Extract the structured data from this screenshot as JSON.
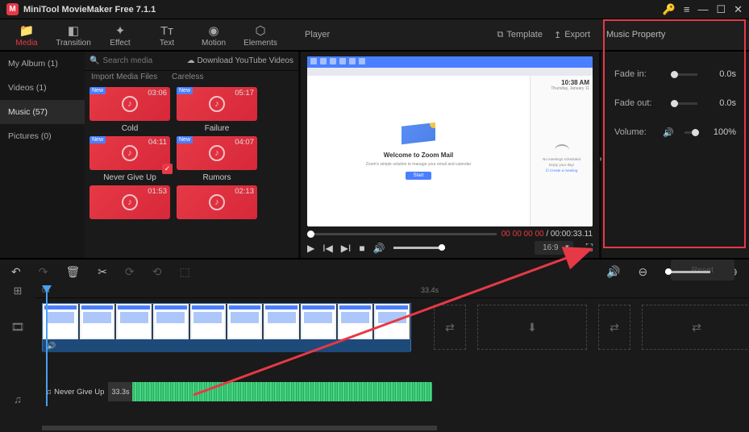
{
  "app": {
    "title": "MiniTool MovieMaker Free 7.1.1",
    "logo_letter": "M"
  },
  "window_controls": {
    "key": "🔑",
    "menu": "≡",
    "min": "—",
    "max": "☐",
    "close": "✕"
  },
  "tools": [
    {
      "icon": "📁",
      "label": "Media",
      "active": true
    },
    {
      "icon": "◧",
      "label": "Transition"
    },
    {
      "icon": "✦",
      "label": "Effect"
    },
    {
      "icon": "Tᴛ",
      "label": "Text"
    },
    {
      "icon": "◉",
      "label": "Motion"
    },
    {
      "icon": "⬡",
      "label": "Elements"
    }
  ],
  "player_header": {
    "title": "Player",
    "template": "Template",
    "export": "Export"
  },
  "prop_header": "Music Property",
  "sidebar": [
    {
      "label": "My Album (1)"
    },
    {
      "label": "Videos (1)"
    },
    {
      "label": "Music (57)",
      "sel": true
    },
    {
      "label": "Pictures (0)"
    }
  ],
  "search": {
    "placeholder": "Search media",
    "download": "Download YouTube Videos",
    "import": "Import Media Files",
    "import2": "Careless"
  },
  "media": [
    [
      {
        "dur": "03:06",
        "name": "Cold",
        "new": true
      },
      {
        "dur": "05:17",
        "name": "Failure",
        "new": true
      }
    ],
    [
      {
        "dur": "04:11",
        "name": "Never Give Up",
        "new": true,
        "checked": true
      },
      {
        "dur": "04:07",
        "name": "Rumors",
        "new": true
      }
    ],
    [
      {
        "dur": "01:53",
        "name": ""
      },
      {
        "dur": "02:13",
        "name": ""
      }
    ]
  ],
  "preview": {
    "welcome": "Welcome to Zoom Mail",
    "sub": "Zoom's simple solution to manage your email and calendar",
    "btn": "Start",
    "clock_time": "10:38 AM",
    "clock_date": "Thursday, January 11",
    "cal1": "No meetings scheduled",
    "cal2": "Enjoy your day!",
    "cal3": "☑ Create a meeting"
  },
  "seek": {
    "current": "00 00 00 00",
    "total": "00:00:33.11"
  },
  "aspect": "16:9",
  "props": {
    "fade_in": {
      "label": "Fade in:",
      "val": "0.0s",
      "pos": 0
    },
    "fade_out": {
      "label": "Fade out:",
      "val": "0.0s",
      "pos": 0
    },
    "volume": {
      "label": "Volume:",
      "val": "100%",
      "pos": 60
    },
    "reset": "Reset"
  },
  "ruler": {
    "t0": "0s",
    "t1": "33.4s"
  },
  "clip": {
    "audio_icon": "🔊"
  },
  "aclip": {
    "name": "Never Give Up",
    "dur": "33.3s"
  }
}
